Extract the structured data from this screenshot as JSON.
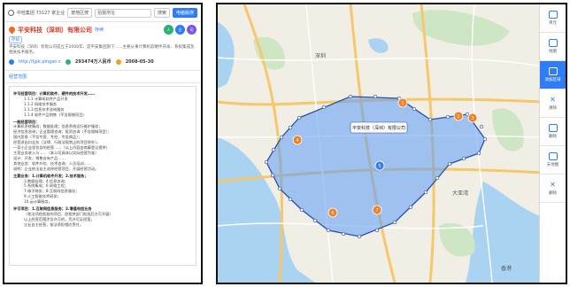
{
  "search_bar": {
    "company_label": "中检集团 73127 家企业",
    "scope_label": "按地区搜",
    "query": "拍摄地址",
    "filter": "搜索",
    "button": "电脑版搜"
  },
  "company": {
    "name": "平安科技（深圳）有限公司",
    "tag": "存续",
    "badges": [
      "人",
      "企",
      "司"
    ],
    "chip": "存续",
    "description": "平安科技（深圳）有限公司成立于2008年，是平安集团旗下……主要从事计算机软硬件开发、系统集成及相关技术服务。",
    "website": "http://tjpk.pingan.c",
    "registered_capital": "293474万人民币",
    "founded": "2008-05-30"
  },
  "scope_section": {
    "title": "经营范围",
    "lines": [
      {
        "text": "许可经营项目：计算机软件、硬件的技术开发……",
        "style": "head"
      },
      {
        "text": "1.1.1 计算机软件产品开发",
        "style": "indent"
      },
      {
        "text": "1.1.2 网络技术服务",
        "style": "indent"
      },
      {
        "text": "1.1.3 信息技术咨询服务",
        "style": "indent"
      },
      {
        "text": "1.1.4 软件产品销售（不含限制项目）",
        "style": "indent"
      },
      {
        "text": "一般经营项目：",
        "style": "head"
      },
      {
        "text": "计算机系统集成；数据处理；信息系统运行维护服务；",
        "style": "plain"
      },
      {
        "text": "经济信息咨询；企业管理咨询；投资咨询（不含限制项目）；",
        "style": "plain"
      },
      {
        "text": "国内贸易（不含专营、专控、专卖商品）；",
        "style": "plain"
      },
      {
        "text": "经营进出口业务（法律、行政法规禁止的项目除外）。",
        "style": "plain"
      },
      {
        "text": "一家小企业里包含的经营……（以上内容由商事登记提供）",
        "style": "plain"
      },
      {
        "text": "主营业务收入与……（本公司具体以实际经营为准）",
        "style": "plain"
      },
      {
        "text": "设计、开发、销售自有产品……",
        "style": "plain"
      },
      {
        "text": "其他业务：软件外包、技术咨询、人员培训……",
        "style": "plain"
      },
      {
        "text": "说明：企业依法自主选择经营项目，开展经营活动。",
        "style": "plain"
      },
      {
        "text": "主要业务：1.计算机软件开发；2.技术服务；",
        "style": "head"
      },
      {
        "text": "3.数据处理；4.信息咨询；",
        "style": "indent"
      },
      {
        "text": "5.系统集成；6.网络工程；",
        "style": "indent"
      },
      {
        "text": "7.电子商务；8.互联网信息服务；",
        "style": "indent"
      },
      {
        "text": "9.人工智能技术研发；",
        "style": "indent"
      },
      {
        "text": "10.云计算服务。",
        "style": "indent"
      },
      {
        "text": "许可项目：1.互联网信息服务；2.增值电信业务",
        "style": "head"
      },
      {
        "text": "（依法须经批准的项目，经相关部门批准后方可开展）",
        "style": "indent"
      },
      {
        "text": "以上经营范围涉及许可的，凭许可证经营。",
        "style": "indent"
      },
      {
        "text": "企业自主经营，依法承担相应责任。",
        "style": "indent"
      }
    ]
  },
  "map": {
    "company_label": "平安科技（深圳）有限公司",
    "labels": [
      "大亚湾",
      "深圳",
      "香港"
    ],
    "markers": [
      "1",
      "2",
      "3",
      "4",
      "5",
      "6",
      "7"
    ],
    "accent": "#2e7cf6",
    "region_fill": "#5b9cf5",
    "region_stroke": "#2a4fa8",
    "marker_color": "#f0812b",
    "water": "#aad3f2",
    "land": "#f1eee6"
  },
  "toolbar": {
    "items": [
      {
        "label": "单元",
        "icon": "pin-icon"
      },
      {
        "label": "地图",
        "icon": "map-icon"
      },
      {
        "label": "添加区域",
        "icon": "area-icon"
      },
      {
        "label": "清除",
        "icon": "close-icon"
      },
      {
        "label": "删除",
        "icon": "delete-icon"
      },
      {
        "label": "天地图",
        "icon": "layer-icon"
      },
      {
        "label": "删除",
        "icon": "close-icon"
      }
    ]
  }
}
